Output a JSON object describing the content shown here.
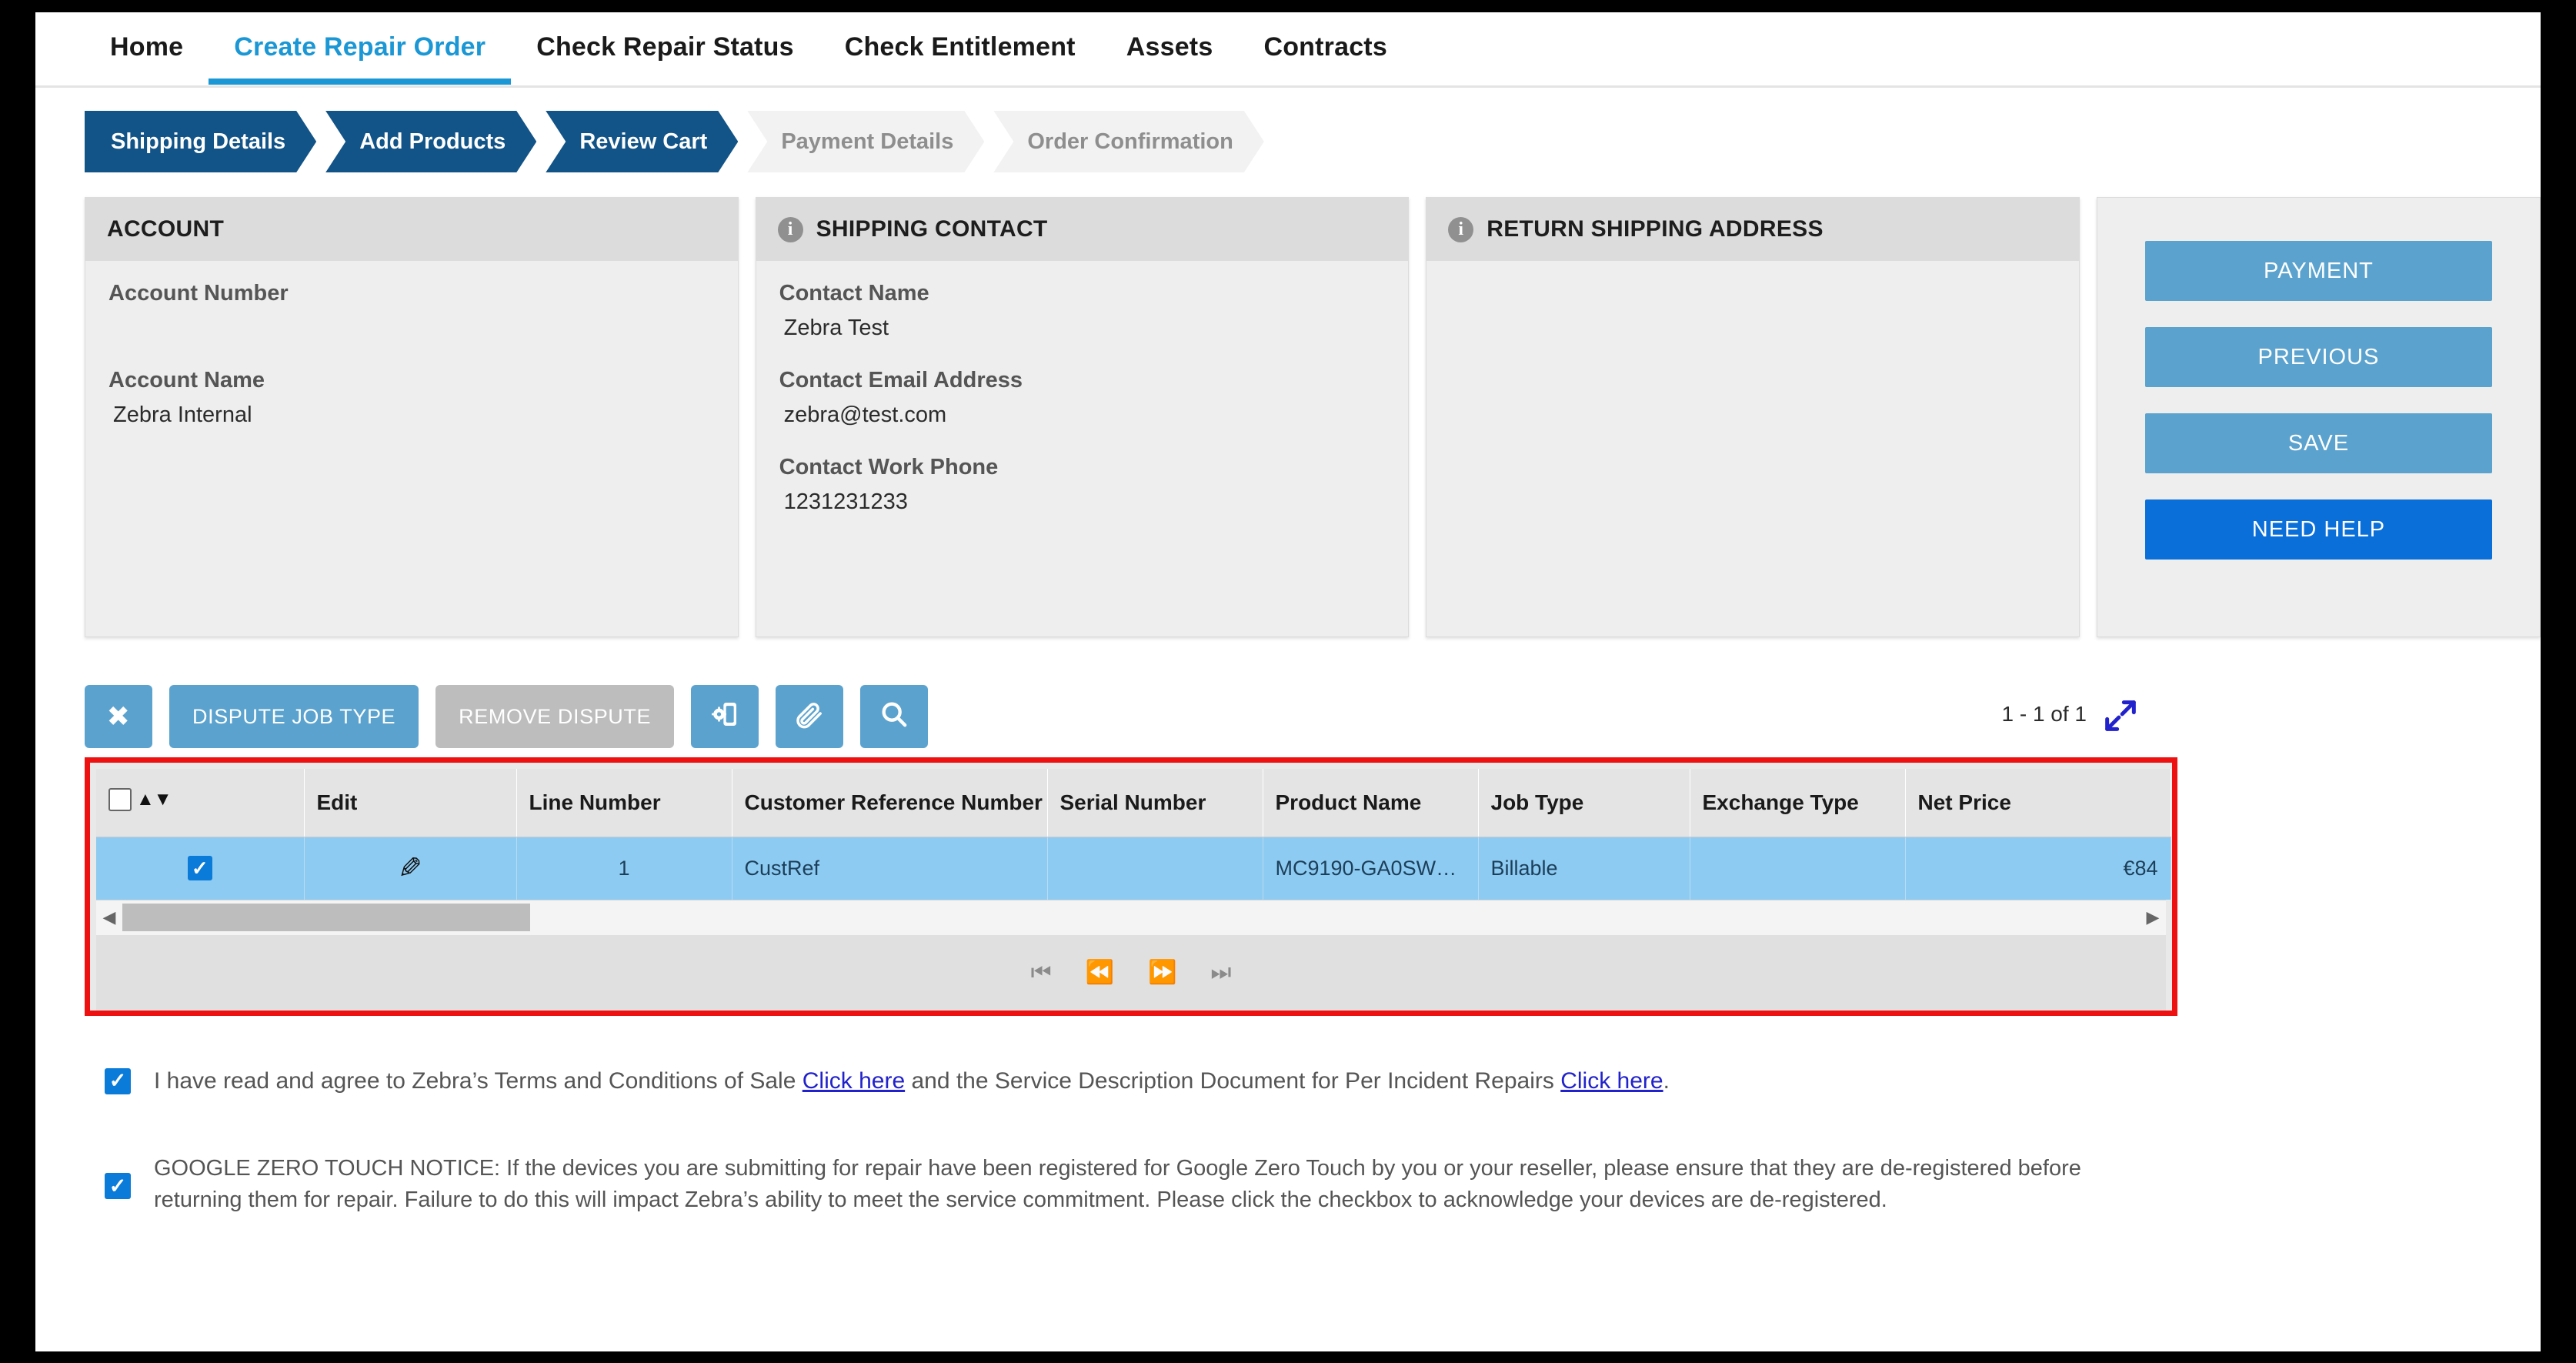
{
  "nav": {
    "items": [
      {
        "label": "Home",
        "active": false
      },
      {
        "label": "Create Repair Order",
        "active": true
      },
      {
        "label": "Check Repair Status",
        "active": false
      },
      {
        "label": "Check Entitlement",
        "active": false
      },
      {
        "label": "Assets",
        "active": false
      },
      {
        "label": "Contracts",
        "active": false
      }
    ]
  },
  "stepper": {
    "steps": [
      {
        "label": "Shipping Details",
        "state": "done"
      },
      {
        "label": "Add Products",
        "state": "done"
      },
      {
        "label": "Review Cart",
        "state": "current"
      },
      {
        "label": "Payment Details",
        "state": "upcoming"
      },
      {
        "label": "Order Confirmation",
        "state": "upcoming"
      }
    ]
  },
  "account_card": {
    "title": "ACCOUNT",
    "fields": [
      {
        "label": "Account Number",
        "value": ""
      },
      {
        "label": "Account Name",
        "value": "Zebra Internal"
      }
    ]
  },
  "shipping_contact_card": {
    "title": "SHIPPING CONTACT",
    "info_icon": "info-icon",
    "fields": [
      {
        "label": "Contact Name",
        "value": "Zebra Test"
      },
      {
        "label": "Contact Email Address",
        "value": "zebra@test.com"
      },
      {
        "label": "Contact Work Phone",
        "value": "1231231233"
      }
    ]
  },
  "return_address_card": {
    "title": "RETURN SHIPPING ADDRESS",
    "info_icon": "info-icon",
    "body": ""
  },
  "actions": {
    "payment": "PAYMENT",
    "previous": "PREVIOUS",
    "save": "SAVE",
    "need_help": "NEED HELP",
    "accent": "#5ba3ce",
    "primary_accent": "#0b6fd9"
  },
  "grid_toolbar": {
    "close_glyph": "✖",
    "dispute_job_type": "DISPUTE JOB TYPE",
    "remove_dispute": "REMOVE DISPUTE",
    "device_icon": "device-settings-icon",
    "attach_icon": "paperclip-icon",
    "search_icon": "search-icon",
    "page_label": "1 - 1 of 1",
    "expand_icon": "expand-arrows-icon"
  },
  "grid": {
    "highlight_color": "#ee1111",
    "columns": [
      "",
      "Edit",
      "Line Number",
      "Customer Reference Number",
      "Serial Number",
      "Product Name",
      "Job Type",
      "Exchange Type",
      "Net Price"
    ],
    "rows": [
      {
        "selected": true,
        "edit_icon": "pencil-icon",
        "line_number": "1",
        "customer_reference_number": "CustRef",
        "serial_number": "",
        "product_name": "MC9190-GA0SW…",
        "job_type": "Billable",
        "exchange_type": "",
        "net_price": "€84"
      }
    ],
    "pager": {
      "first": "⏮",
      "prev": "⏪",
      "next": "⏩",
      "last": "⏭"
    }
  },
  "agreements": {
    "terms": {
      "checked": true,
      "text_part1": "I have read and agree to Zebra’s Terms and Conditions of Sale ",
      "link1": "Click here",
      "text_part2": " and the Service Description Document for Per Incident Repairs ",
      "link2": "Click here",
      "text_part3": "."
    },
    "zero_touch": {
      "checked": true,
      "text": "GOOGLE ZERO TOUCH NOTICE: If the devices you are submitting for repair have been registered for Google Zero Touch by you or your reseller, please ensure that they are de-registered before returning them for repair. Failure to do this will impact Zebra’s ability to meet the service commitment. Please click the checkbox to acknowledge your devices are de-registered."
    }
  }
}
